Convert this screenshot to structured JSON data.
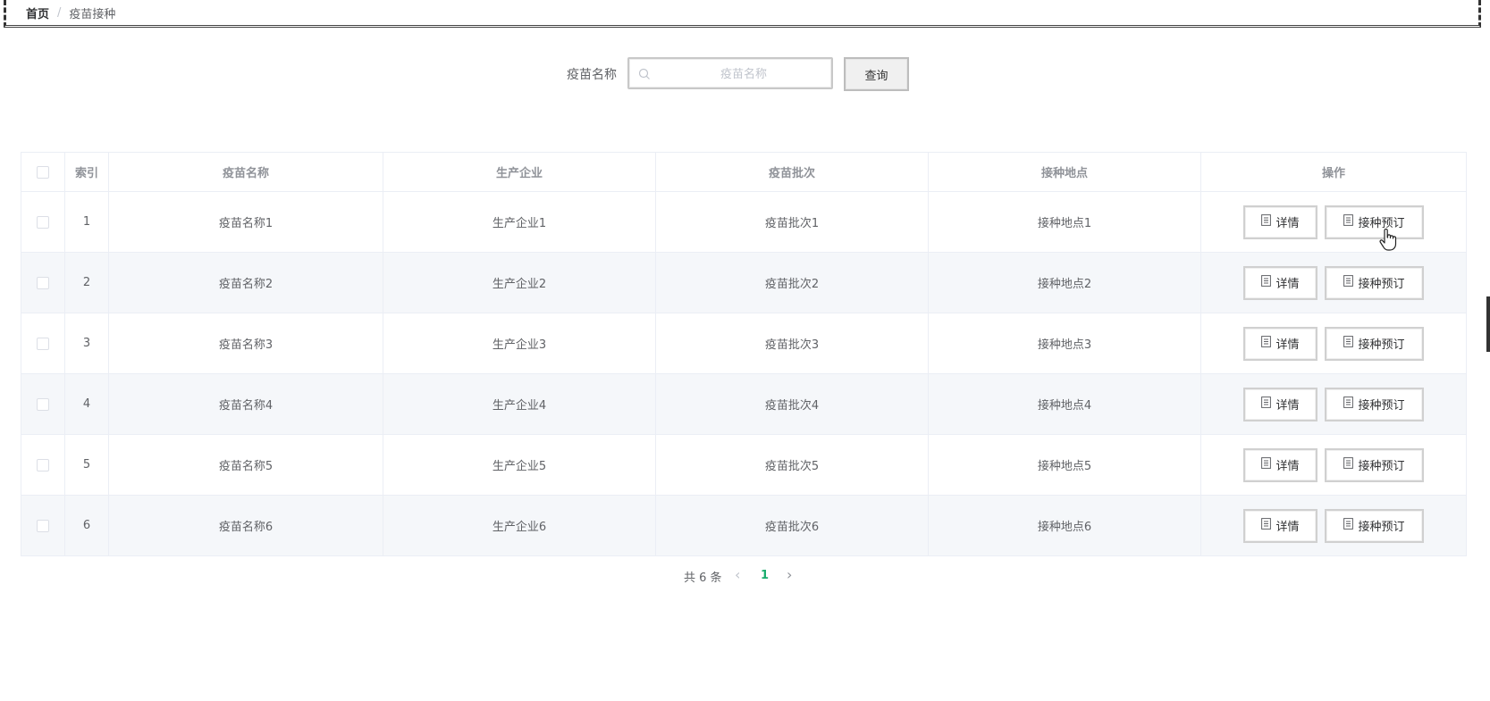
{
  "breadcrumb": {
    "home": "首页",
    "separator": "/",
    "current": "疫苗接种"
  },
  "search": {
    "label": "疫苗名称",
    "placeholder": "疫苗名称",
    "value": "",
    "button_label": "查询"
  },
  "table": {
    "columns": [
      "",
      "索引",
      "疫苗名称",
      "生产企业",
      "疫苗批次",
      "接种地点",
      "操作"
    ],
    "rows": [
      {
        "index": "1",
        "name": "疫苗名称1",
        "maker": "生产企业1",
        "batch": "疫苗批次1",
        "site": "接种地点1"
      },
      {
        "index": "2",
        "name": "疫苗名称2",
        "maker": "生产企业2",
        "batch": "疫苗批次2",
        "site": "接种地点2"
      },
      {
        "index": "3",
        "name": "疫苗名称3",
        "maker": "生产企业3",
        "batch": "疫苗批次3",
        "site": "接种地点3"
      },
      {
        "index": "4",
        "name": "疫苗名称4",
        "maker": "生产企业4",
        "batch": "疫苗批次4",
        "site": "接种地点4"
      },
      {
        "index": "5",
        "name": "疫苗名称5",
        "maker": "生产企业5",
        "batch": "疫苗批次5",
        "site": "接种地点5"
      },
      {
        "index": "6",
        "name": "疫苗名称6",
        "maker": "生产企业6",
        "batch": "疫苗批次6",
        "site": "接种地点6"
      }
    ],
    "actions": {
      "detail": "详情",
      "book": "接种预订"
    }
  },
  "pagination": {
    "total_text": "共 6 条",
    "current_page": "1",
    "prev_icon": "chevron-left",
    "next_icon": "chevron-right"
  },
  "colors": {
    "accent": "#1aad6e",
    "header_text": "#909399",
    "stripe": "#f5f7fa",
    "border": "#ebeef5"
  },
  "icons": {
    "search": "search-icon",
    "document": "document-icon",
    "cursor": "hand-pointer-icon"
  }
}
